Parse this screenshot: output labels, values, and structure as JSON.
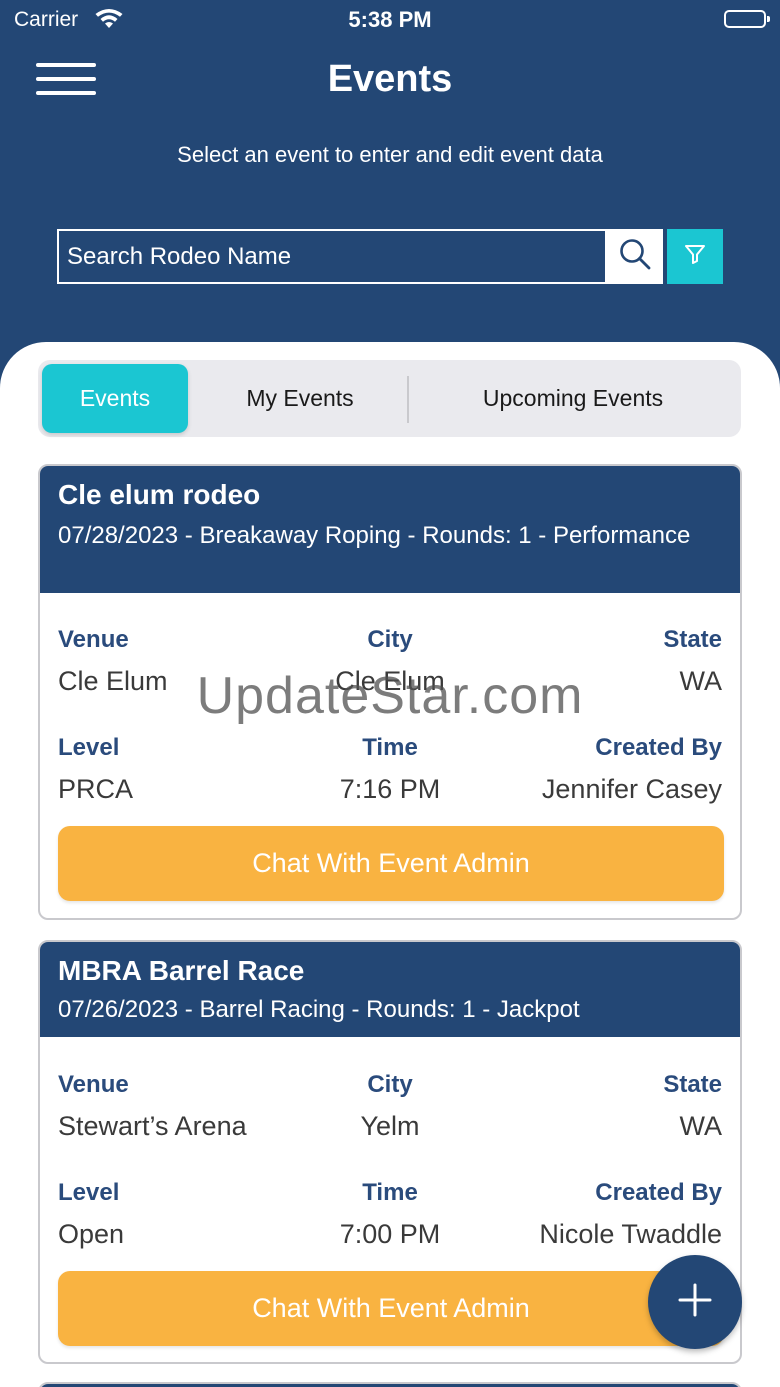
{
  "status_bar": {
    "carrier": "Carrier",
    "time": "5:38 PM"
  },
  "header": {
    "title": "Events",
    "subtitle": "Select an event to enter and edit event data"
  },
  "search": {
    "placeholder": "Search Rodeo Name",
    "value": ""
  },
  "tabs": [
    {
      "label": "Events",
      "active": true
    },
    {
      "label": "My Events",
      "active": false
    },
    {
      "label": "Upcoming Events",
      "active": false
    }
  ],
  "labels": {
    "venue": "Venue",
    "city": "City",
    "state": "State",
    "level": "Level",
    "time": "Time",
    "created_by": "Created By",
    "chat_button": "Chat With Event Admin"
  },
  "events": [
    {
      "name": "Cle elum rodeo",
      "details": "07/28/2023 - Breakaway Roping - Rounds: 1 - Performance",
      "venue": "Cle Elum",
      "city": "Cle Elum",
      "state": "WA",
      "level": "PRCA",
      "time": "7:16 PM",
      "created_by": "Jennifer Casey"
    },
    {
      "name": "MBRA Barrel Race",
      "details": "07/26/2023 - Barrel Racing - Rounds: 1 - Jackpot",
      "venue": "Stewart’s Arena",
      "city": "Yelm",
      "state": "WA",
      "level": "Open",
      "time": "7:00 PM",
      "created_by": "Nicole Twaddle"
    }
  ],
  "watermark": "UpdateStar.com",
  "colors": {
    "header_bg": "#234775",
    "accent_cyan": "#1bc6d2",
    "chat_button": "#f9b341",
    "label_blue": "#2a4b7c"
  },
  "icons": {
    "menu": "hamburger-icon",
    "search": "search-icon",
    "filter": "filter-icon",
    "add": "plus-icon"
  }
}
